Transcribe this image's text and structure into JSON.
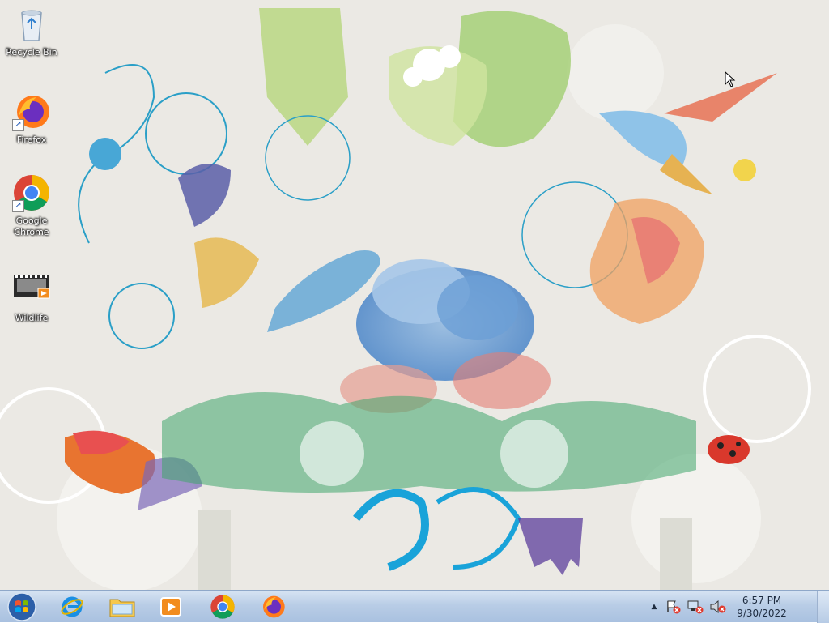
{
  "desktop": {
    "icons": [
      {
        "label": "Recycle Bin",
        "icon": "recycle-bin-icon"
      },
      {
        "label": "Firefox",
        "icon": "firefox-icon"
      },
      {
        "label": "Google Chrome",
        "icon": "chrome-icon"
      },
      {
        "label": "Wildlife",
        "icon": "video-file-icon"
      }
    ]
  },
  "taskbar": {
    "pinned": [
      {
        "name": "internet-explorer",
        "icon": "internet-explorer-icon"
      },
      {
        "name": "file-explorer",
        "icon": "folder-icon"
      },
      {
        "name": "media-player",
        "icon": "media-player-icon"
      },
      {
        "name": "chrome",
        "icon": "chrome-icon"
      },
      {
        "name": "firefox",
        "icon": "firefox-icon"
      }
    ],
    "tray": {
      "icons": [
        "show-hidden-icons-arrow",
        "action-center-icon",
        "network-icon",
        "volume-muted-icon"
      ]
    },
    "clock": {
      "time": "6:57 PM",
      "date": "9/30/2022"
    }
  },
  "colors": {
    "taskbar": "#b9cde6",
    "desktop_background": "#ebe9e4"
  }
}
